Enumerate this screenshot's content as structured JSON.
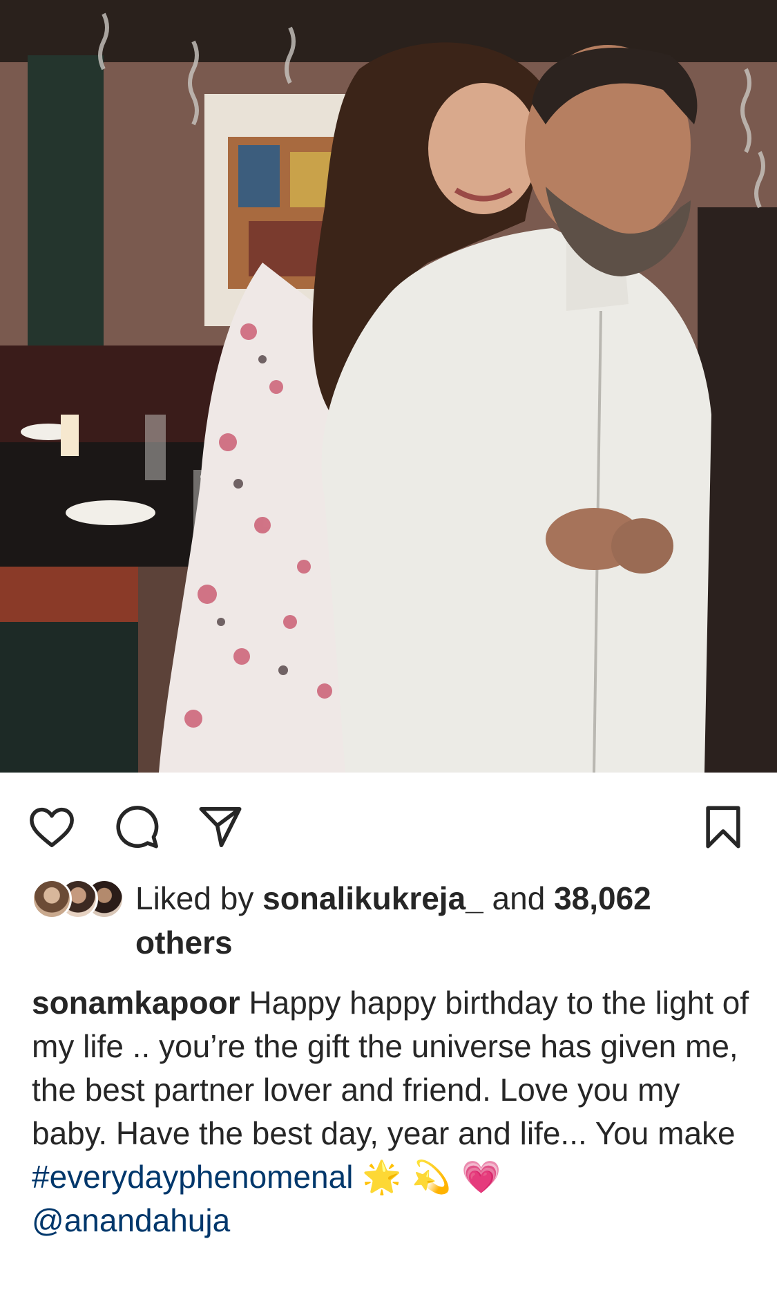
{
  "post": {
    "image_alt": "Couple embracing at a restaurant, woman in floral dress hugging man in white shirt from behind",
    "actions": {
      "like_icon": "heart-icon",
      "comment_icon": "comment-icon",
      "share_icon": "paper-plane-icon",
      "save_icon": "bookmark-icon"
    },
    "likes": {
      "prefix": "Liked by",
      "user": "sonalikukreja_",
      "middle": "and",
      "count": "38,062",
      "suffix": "others"
    },
    "caption": {
      "username": "sonamkapoor",
      "text": "Happy happy birthday to the light of my life .. you’re the gift the universe has given me, the best partner lover and friend. Love you my baby. Have the best day, year and life... You make",
      "hashtag": "#everydayphenomenal",
      "emojis": "🌟 💫 💗",
      "mention": "@anandahuja"
    }
  },
  "colors": {
    "text": "#262626",
    "link": "#00376b",
    "background": "#ffffff"
  }
}
